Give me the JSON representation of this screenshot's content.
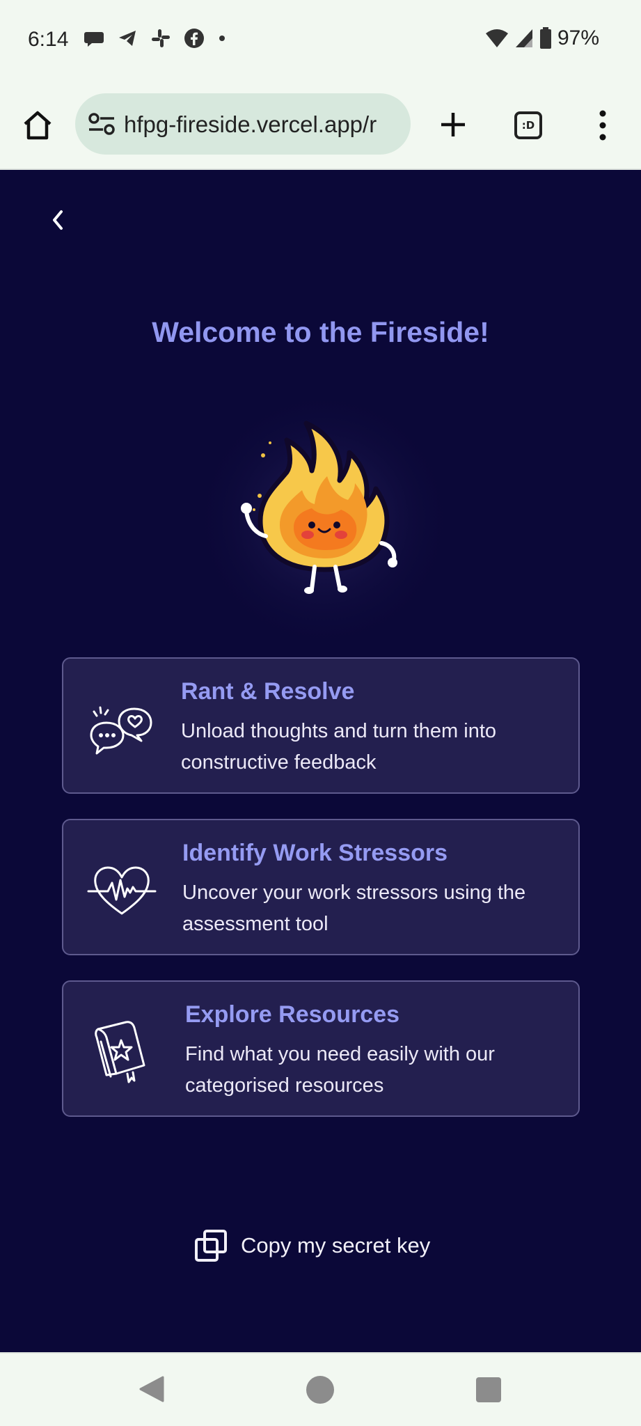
{
  "status_bar": {
    "time": "6:14",
    "battery_percent": "97%",
    "notification_icons": [
      "chat-icon",
      "telegram-icon",
      "slack-icon",
      "facebook-icon",
      "dot-icon"
    ]
  },
  "browser": {
    "url": "hfpg-fireside.vercel.app/r",
    "tab_icon_text": ":D"
  },
  "page": {
    "title": "Welcome to the Fireside!",
    "cards": [
      {
        "title": "Rant & Resolve",
        "description": "Unload thoughts and turn them into constructive feedback",
        "icon": "chat-bubbles-heart-icon"
      },
      {
        "title": "Identify Work Stressors",
        "description": "Uncover your work stressors using the assessment tool",
        "icon": "heartbeat-icon"
      },
      {
        "title": "Explore Resources",
        "description": "Find what you need easily with our categorised resources",
        "icon": "book-star-icon"
      }
    ],
    "copy_key_label": "Copy my secret key"
  },
  "colors": {
    "background": "#0b0838",
    "card_bg": "#231f4f",
    "accent": "#9197f0",
    "chrome_bg": "#f2f8f1"
  }
}
